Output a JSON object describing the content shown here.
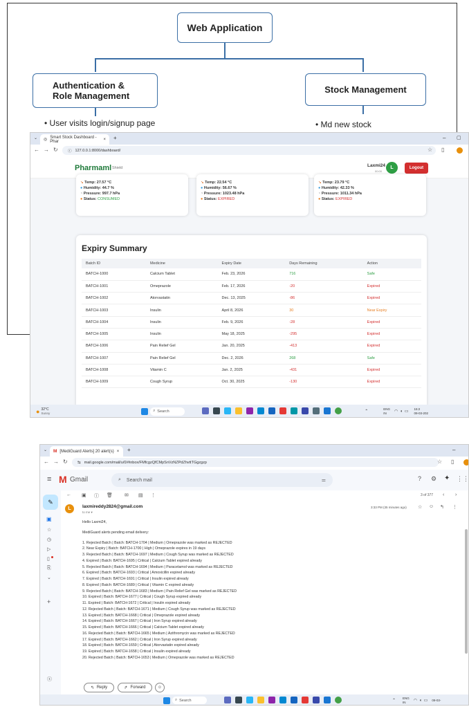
{
  "diagram": {
    "root": "Web Application",
    "left_box": [
      "Authentication &",
      "Role Management"
    ],
    "right_box": "Stock Management",
    "left_bullet": "User visits login/signup page",
    "right_bullet": "Md new stock"
  },
  "browser1": {
    "tab_title": "Smart Stock Dashboard - Phar",
    "url": "127.0.0.1:8000/dashboard/",
    "brand": "Pharmaml",
    "brand_sub": "Shield",
    "user": "Laxmi24",
    "user_sub": "00:00",
    "avatar_letter": "L",
    "logout_label": "Logout",
    "sensors": [
      {
        "temp": "Temp: 27.57 °C",
        "humidity": "Humidity: 44.7 %",
        "pressure": "Pressure: 997.7 hPa",
        "status_label": "Status:",
        "status": "CONSUMED",
        "status_color": "#2e9e44"
      },
      {
        "temp": "Temp: 22.54 °C",
        "humidity": "Humidity: 56.67 %",
        "pressure": "Pressure: 1023.48 hPa",
        "status_label": "Status:",
        "status": "EXPIRED",
        "status_color": "#d32f2f"
      },
      {
        "temp": "Temp: 23.79 °C",
        "humidity": "Humidity: 42.33 %",
        "pressure": "Pressure: 1011.34 hPa",
        "status_label": "Status:",
        "status": "EXPIRED",
        "status_color": "#d32f2f"
      }
    ],
    "expiry_title": "Expiry Summary",
    "columns": [
      "Batch ID",
      "Medicine",
      "Expiry Date",
      "Days Remaining",
      "Action"
    ],
    "rows": [
      {
        "batch": "BATCH-1000",
        "medicine": "Calcium Tablet",
        "date": "Feb. 23, 2026",
        "days": "716",
        "action": "Safe",
        "color": "#2e9e44"
      },
      {
        "batch": "BATCH-1001",
        "medicine": "Omeprazole",
        "date": "Feb. 17, 2026",
        "days": "-20",
        "action": "Expired",
        "color": "#d32f2f"
      },
      {
        "batch": "BATCH-1002",
        "medicine": "Atorvastatin",
        "date": "Dec. 13, 2025",
        "days": "-86",
        "action": "Expired",
        "color": "#d32f2f"
      },
      {
        "batch": "BATCH-1003",
        "medicine": "Insulin",
        "date": "April 8, 2026",
        "days": "30",
        "action": "Near Expiry",
        "color": "#e67e22"
      },
      {
        "batch": "BATCH-1004",
        "medicine": "Insulin",
        "date": "Feb. 9, 2026",
        "days": "-28",
        "action": "Expired",
        "color": "#d32f2f"
      },
      {
        "batch": "BATCH-1005",
        "medicine": "Insulin",
        "date": "May 18, 2025",
        "days": "-295",
        "action": "Expired",
        "color": "#d32f2f"
      },
      {
        "batch": "BATCH-1006",
        "medicine": "Pain Relief Gel",
        "date": "Jan. 20, 2025",
        "days": "-413",
        "action": "Expired",
        "color": "#d32f2f"
      },
      {
        "batch": "BATCH-1007",
        "medicine": "Pain Relief Gel",
        "date": "Dec. 2, 2026",
        "days": "268",
        "action": "Safe",
        "color": "#2e9e44"
      },
      {
        "batch": "BATCH-1008",
        "medicine": "Vitamin C",
        "date": "Jan. 2, 2025",
        "days": "-431",
        "action": "Expired",
        "color": "#d32f2f"
      },
      {
        "batch": "BATCH-1009",
        "medicine": "Cough Syrup",
        "date": "Oct. 30, 2025",
        "days": "-130",
        "action": "Expired",
        "color": "#d32f2f"
      }
    ],
    "weather_temp": "32°C",
    "weather_desc": "Sunny",
    "search_label": "Search",
    "lang": "ENG",
    "lang_sub": "IN",
    "clock_time": "15:2",
    "clock_date": "09-03-202"
  },
  "browser2": {
    "tab_title": "[MediGuard Alerts] 20 alert(s)",
    "url": "mail.google.com/mail/u/0/#inbox/FMfcgzQfCMpSnVzNZPdZhvttTGgzgzp",
    "gmail_label": "Gmail",
    "search_placeholder": "Search mail",
    "counter": "3 of 377",
    "sender": "laxmireddy2824@gmail.com",
    "to": "to me",
    "time": "3:33 PM (35 minutes ago)",
    "sender_initial": "L",
    "greeting": "Hello Laxmi24,",
    "intro": "MediGuard alerts pending email delivery:",
    "alerts": [
      "1. Rejected Batch | Batch: BATCH-1704 | Medium | Omeprazole was marked as REJECTED",
      "2. Near Expiry | Batch: BATCH-1700 | High | Omeprazole expires in 19 days",
      "3. Rejected Batch | Batch: BATCH-1697 | Medium | Cough Syrup was marked as REJECTED",
      "4. Expired | Batch: BATCH-1695 | Critical | Calcium Tablet expired already",
      "5. Rejected Batch | Batch: BATCH-1694 | Medium | Paracetamol was marked as REJECTED",
      "6. Expired | Batch: BATCH-1693 | Critical | Amoxicillin expired already",
      "7. Expired | Batch: BATCH-1691 | Critical | Insulin expired already",
      "8. Expired | Batch: BATCH-1689 | Critical | Vitamin C expired already",
      "9. Rejected Batch | Batch: BATCH-1683 | Medium | Pain Relief Gel was marked as REJECTED",
      "10. Expired | Batch: BATCH-1677 | Critical | Cough Syrup expired already",
      "11. Expired | Batch: BATCH-1672 | Critical | Insulin expired already",
      "12. Rejected Batch | Batch: BATCH-1671 | Medium | Cough Syrup was marked as REJECTED",
      "13. Expired | Batch: BATCH-1668 | Critical | Omeprazole expired already",
      "14. Expired | Batch: BATCH-1667 | Critical | Iron Syrup expired already",
      "15. Expired | Batch: BATCH-1666 | Critical | Calcium Tablet expired already",
      "16. Rejected Batch | Batch: BATCH-1665 | Medium | Azithromycin was marked as REJECTED",
      "17. Expired | Batch: BATCH-1662 | Critical | Iron Syrup expired already",
      "18. Expired | Batch: BATCH-1659 | Critical | Atorvastatin expired already",
      "19. Expired | Batch: BATCH-1658 | Critical | Insulin expired already",
      "20. Rejected Batch | Batch: BATCH-1653 | Medium | Omeprazole was marked as REJECTED"
    ],
    "reply_label": "Reply",
    "forward_label": "Forward",
    "search_label": "Search",
    "lang": "ENG",
    "lang_sub": "IN",
    "clock_date": "09-03-"
  },
  "colors": {
    "accent": "#3a6ea5",
    "brand_green": "#1f7a3a",
    "logout_red": "#d32f2f",
    "avatar_green": "#2e9e44",
    "gmail_red": "#d93025"
  }
}
